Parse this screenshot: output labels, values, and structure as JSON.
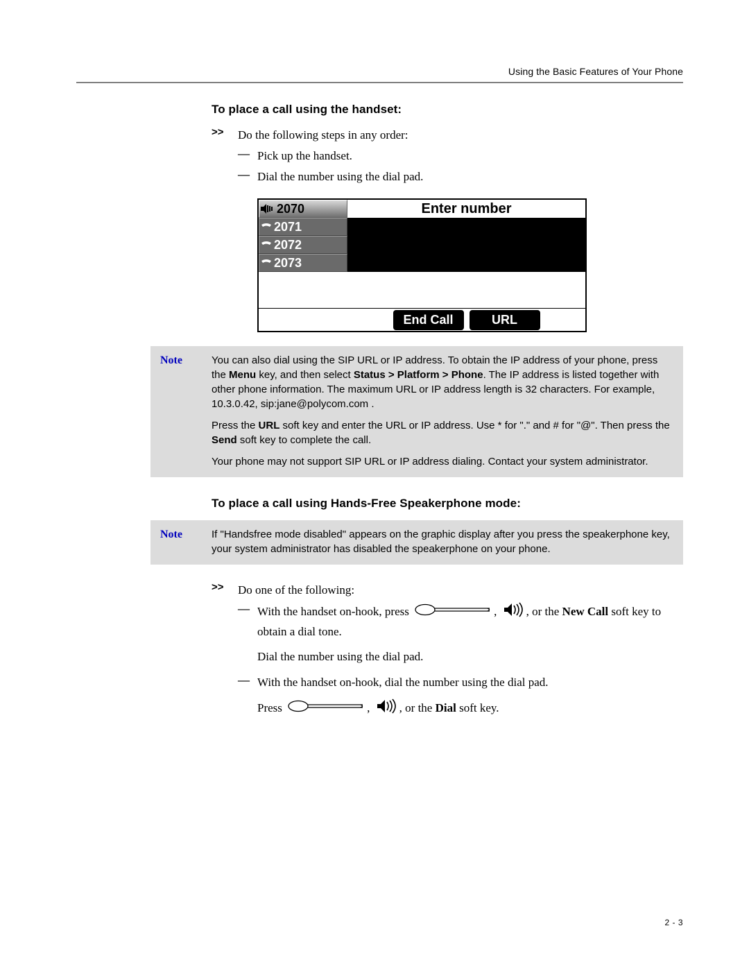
{
  "running_head": "Using the Basic Features of Your Phone",
  "page_number": "2 - 3",
  "section1": {
    "heading": "To place a call using the handset:",
    "step_mark": ">>",
    "step_text": "Do the following steps in any order:",
    "dash": "—",
    "bullet_a": "Pick up the handset.",
    "bullet_b": "Dial the number using the dial pad."
  },
  "phone": {
    "lines": [
      "2070",
      "2071",
      "2072",
      "2073"
    ],
    "title": "Enter number",
    "softkeys": [
      "End Call",
      "URL"
    ]
  },
  "note1": {
    "label": "Note",
    "p1_a": "You can also dial using the SIP URL or IP address. To obtain the IP address of your phone, press the ",
    "p1_menu": "Menu",
    "p1_b": " key, and then select ",
    "p1_path": "Status > Platform > Phone",
    "p1_c": ". The IP address is listed together with other phone information. The maximum URL or IP address length is 32 characters. For example, 10.3.0.42, sip:jane@polycom.com .",
    "p2_a": "Press the ",
    "p2_url": "URL",
    "p2_b": " soft key and enter the URL or IP address. Use * for \".\" and # for \"@\". Then press the ",
    "p2_send": "Send",
    "p2_c": " soft key to complete the call.",
    "p3": "Your phone may not support SIP URL or IP address dialing. Contact your system administrator."
  },
  "section2": {
    "heading": "To place a call using Hands-Free Speakerphone mode:"
  },
  "note2": {
    "label": "Note",
    "p1": "If \"Handsfree mode disabled\" appears on the graphic display after you press the speakerphone key, your system administrator has disabled the speakerphone on your phone."
  },
  "section3": {
    "step_mark": ">>",
    "step_text": "Do one of the following:",
    "dash": "—",
    "a_pre": "With the handset on-hook, press ",
    "a_post_comma": ", ",
    "a_tail1": ", or the ",
    "a_newcall": "New Call",
    "a_tail2": " soft key to obtain a dial tone.",
    "a_line2": "Dial the number using the dial pad.",
    "b_text": "With the handset on-hook, dial the number using the dial pad.",
    "b_press": "Press ",
    "b_comma": ", ",
    "b_tail1": ", or the ",
    "b_dial": "Dial",
    "b_tail2": " soft key."
  }
}
